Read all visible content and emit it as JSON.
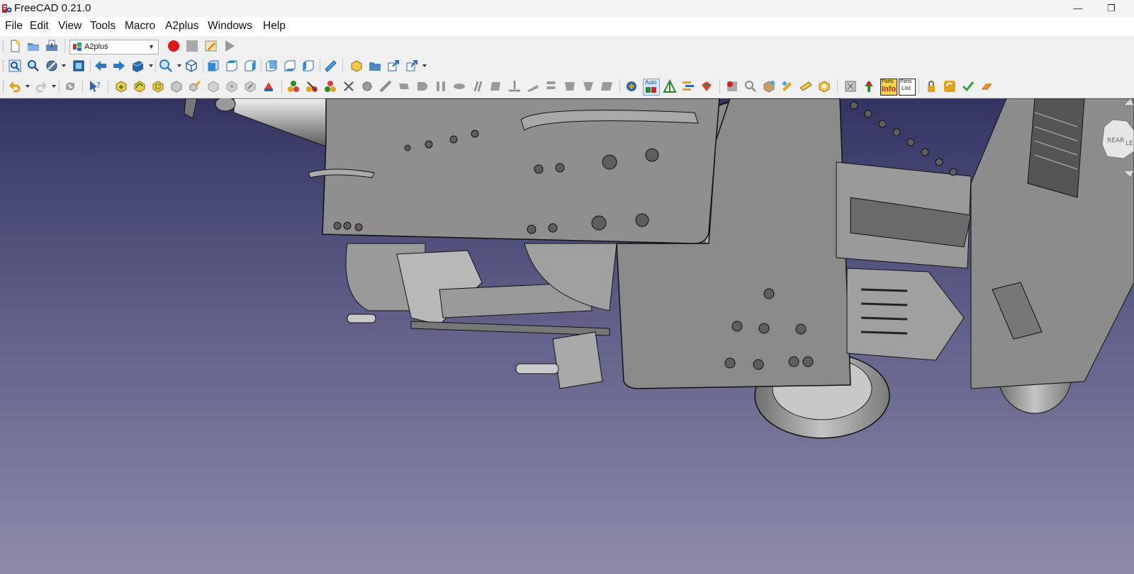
{
  "window": {
    "title": "FreeCAD 0.21.0",
    "minimize": "—",
    "restore": "❐"
  },
  "menu": {
    "items": [
      "File",
      "Edit",
      "View",
      "Tools",
      "Macro",
      "A2plus",
      "Windows",
      "Help"
    ]
  },
  "toolbar1": {
    "workbench": "A2plus"
  },
  "toolbar3": {
    "auto_label": "Auto",
    "parts_info": "Info",
    "parts_label": "Parts",
    "parts_list": "List"
  },
  "navcube": {
    "rear": "REAR",
    "left": "LE"
  },
  "colors": {
    "viewport_top": "#343463",
    "viewport_bottom": "#8c8ca9",
    "model_gray": "#8f8f8f"
  }
}
